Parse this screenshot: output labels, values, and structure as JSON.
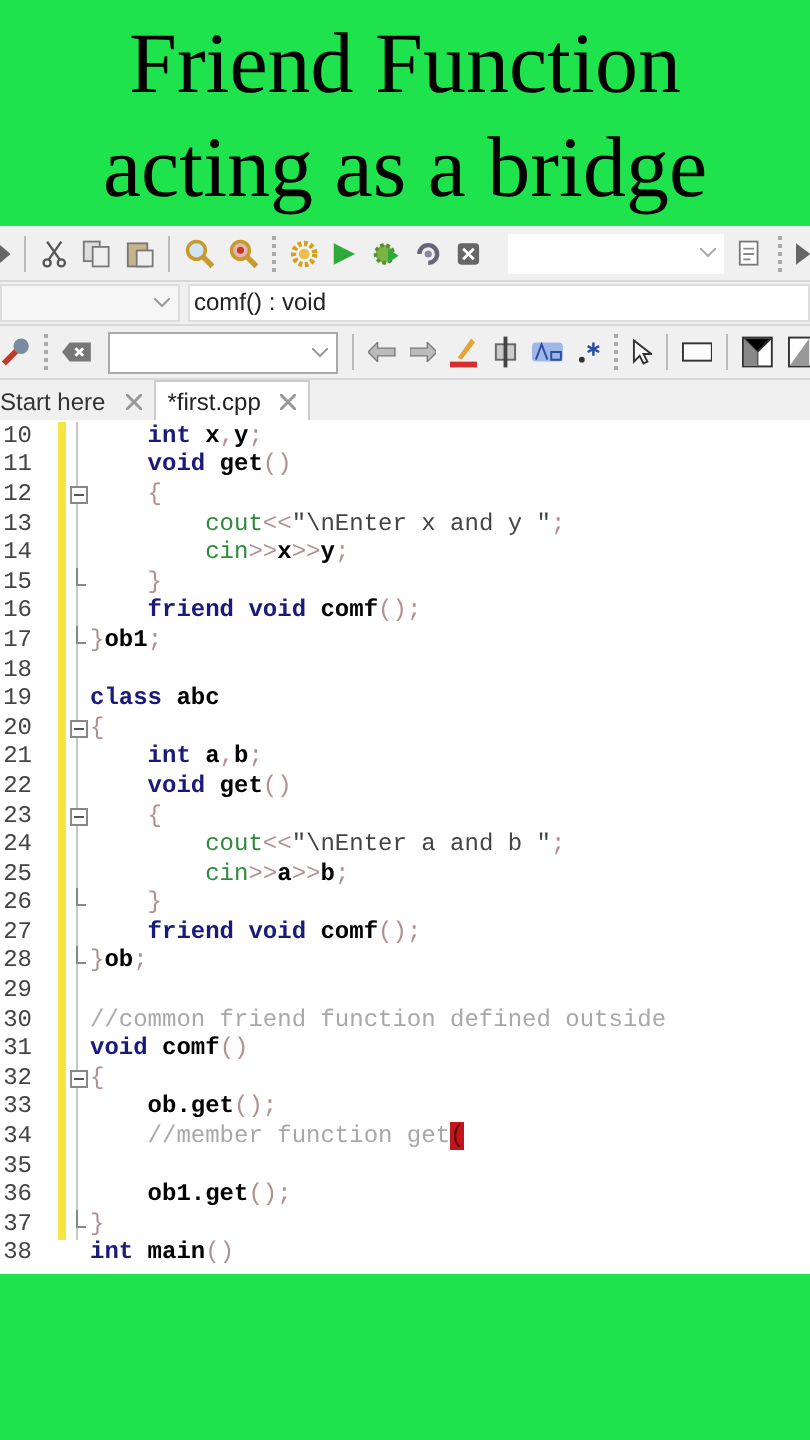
{
  "title": [
    "Friend Function",
    "acting as a bridge"
  ],
  "scope_field": {
    "value": "comf() : void"
  },
  "tabs": [
    {
      "label": "Start here",
      "selected": false
    },
    {
      "label": "*first.cpp",
      "selected": true
    }
  ],
  "editor": {
    "lines": [
      {
        "number": "10",
        "changed": true,
        "kind": "plain",
        "tokens": [
          {
            "kind": "kw",
            "text": "    int"
          },
          {
            "kind": "id",
            "text": " x"
          },
          {
            "kind": "op",
            "text": ","
          },
          {
            "kind": "id",
            "text": "y"
          },
          {
            "kind": "op",
            "text": ";"
          }
        ]
      },
      {
        "number": "11",
        "changed": true,
        "kind": "plain",
        "tokens": [
          {
            "kind": "kw",
            "text": "    void"
          },
          {
            "kind": "id",
            "text": " get"
          },
          {
            "kind": "op",
            "text": "()"
          }
        ]
      },
      {
        "number": "12",
        "changed": true,
        "kind": "open",
        "tokens": [
          {
            "kind": "op",
            "text": "    {"
          }
        ]
      },
      {
        "number": "13",
        "changed": true,
        "kind": "plain",
        "tokens": [
          {
            "kind": "lib",
            "text": "        cout"
          },
          {
            "kind": "op",
            "text": "<<"
          },
          {
            "kind": "str",
            "text": "\"\\nEnter x and y \""
          },
          {
            "kind": "op",
            "text": ";"
          }
        ]
      },
      {
        "number": "14",
        "changed": true,
        "kind": "plain",
        "tokens": [
          {
            "kind": "lib",
            "text": "        cin"
          },
          {
            "kind": "op",
            "text": ">>"
          },
          {
            "kind": "id",
            "text": "x"
          },
          {
            "kind": "op",
            "text": ">>"
          },
          {
            "kind": "id",
            "text": "y"
          },
          {
            "kind": "op",
            "text": ";"
          }
        ]
      },
      {
        "number": "15",
        "changed": true,
        "kind": "close",
        "tokens": [
          {
            "kind": "op",
            "text": "    }"
          }
        ]
      },
      {
        "number": "16",
        "changed": true,
        "kind": "plain",
        "tokens": [
          {
            "kind": "kw",
            "text": "    friend void"
          },
          {
            "kind": "id",
            "text": " comf"
          },
          {
            "kind": "op",
            "text": "();"
          }
        ]
      },
      {
        "number": "17",
        "changed": true,
        "kind": "close",
        "tokens": [
          {
            "kind": "op",
            "text": "}"
          },
          {
            "kind": "id",
            "text": "ob1"
          },
          {
            "kind": "op",
            "text": ";"
          }
        ]
      },
      {
        "number": "18",
        "changed": true,
        "kind": "plain"
      },
      {
        "number": "19",
        "changed": true,
        "kind": "plain",
        "tokens": [
          {
            "kind": "kw",
            "text": "class"
          },
          {
            "kind": "id",
            "text": " abc"
          }
        ]
      },
      {
        "number": "20",
        "changed": true,
        "kind": "open",
        "tokens": [
          {
            "kind": "op",
            "text": "{"
          }
        ]
      },
      {
        "number": "21",
        "changed": true,
        "kind": "plain",
        "tokens": [
          {
            "kind": "kw",
            "text": "    int"
          },
          {
            "kind": "id",
            "text": " a"
          },
          {
            "kind": "op",
            "text": ","
          },
          {
            "kind": "id",
            "text": "b"
          },
          {
            "kind": "op",
            "text": ";"
          }
        ]
      },
      {
        "number": "22",
        "changed": true,
        "kind": "plain",
        "tokens": [
          {
            "kind": "kw",
            "text": "    void"
          },
          {
            "kind": "id",
            "text": " get"
          },
          {
            "kind": "op",
            "text": "()"
          }
        ]
      },
      {
        "number": "23",
        "changed": true,
        "kind": "open",
        "tokens": [
          {
            "kind": "op",
            "text": "    {"
          }
        ]
      },
      {
        "number": "24",
        "changed": true,
        "kind": "plain",
        "tokens": [
          {
            "kind": "lib",
            "text": "        cout"
          },
          {
            "kind": "op",
            "text": "<<"
          },
          {
            "kind": "str",
            "text": "\"\\nEnter a and b \""
          },
          {
            "kind": "op",
            "text": ";"
          }
        ]
      },
      {
        "number": "25",
        "changed": true,
        "kind": "plain",
        "tokens": [
          {
            "kind": "lib",
            "text": "        cin"
          },
          {
            "kind": "op",
            "text": ">>"
          },
          {
            "kind": "id",
            "text": "a"
          },
          {
            "kind": "op",
            "text": ">>"
          },
          {
            "kind": "id",
            "text": "b"
          },
          {
            "kind": "op",
            "text": ";"
          }
        ]
      },
      {
        "number": "26",
        "changed": true,
        "kind": "close",
        "tokens": [
          {
            "kind": "op",
            "text": "    }"
          }
        ]
      },
      {
        "number": "27",
        "changed": true,
        "kind": "plain",
        "tokens": [
          {
            "kind": "kw",
            "text": "    friend void"
          },
          {
            "kind": "id",
            "text": " comf"
          },
          {
            "kind": "op",
            "text": "();"
          }
        ]
      },
      {
        "number": "28",
        "changed": true,
        "kind": "close",
        "tokens": [
          {
            "kind": "op",
            "text": "}"
          },
          {
            "kind": "id",
            "text": "ob"
          },
          {
            "kind": "op",
            "text": ";"
          }
        ]
      },
      {
        "number": "29",
        "changed": true,
        "kind": "plain"
      },
      {
        "number": "30",
        "changed": true,
        "kind": "plain",
        "tokens": [
          {
            "kind": "cm",
            "text": "//common friend function defined outside"
          }
        ]
      },
      {
        "number": "31",
        "changed": true,
        "kind": "plain",
        "tokens": [
          {
            "kind": "kw",
            "text": "void"
          },
          {
            "kind": "id",
            "text": " comf"
          },
          {
            "kind": "op",
            "text": "()"
          }
        ]
      },
      {
        "number": "32",
        "changed": true,
        "kind": "open",
        "tokens": [
          {
            "kind": "op",
            "text": "{"
          }
        ]
      },
      {
        "number": "33",
        "changed": true,
        "kind": "plain",
        "tokens": [
          {
            "kind": "id",
            "text": "    ob.get"
          },
          {
            "kind": "op",
            "text": "();"
          }
        ]
      },
      {
        "number": "34",
        "changed": true,
        "kind": "plain",
        "tokens": [
          {
            "kind": "cm",
            "text": "    //member function get"
          },
          {
            "kind": "err",
            "text": "("
          }
        ]
      },
      {
        "number": "35",
        "changed": true,
        "kind": "plain"
      },
      {
        "number": "36",
        "changed": true,
        "kind": "plain",
        "tokens": [
          {
            "kind": "id",
            "text": "    ob1.get"
          },
          {
            "kind": "op",
            "text": "();"
          }
        ]
      },
      {
        "number": "37",
        "changed": true,
        "kind": "close",
        "tokens": [
          {
            "kind": "op",
            "text": "}"
          }
        ]
      },
      {
        "number": "38",
        "changed": false,
        "kind": "plain",
        "tokens": [
          {
            "kind": "kw",
            "text": "int"
          },
          {
            "kind": "id",
            "text": " main"
          },
          {
            "kind": "op",
            "text": "()"
          }
        ]
      }
    ]
  }
}
